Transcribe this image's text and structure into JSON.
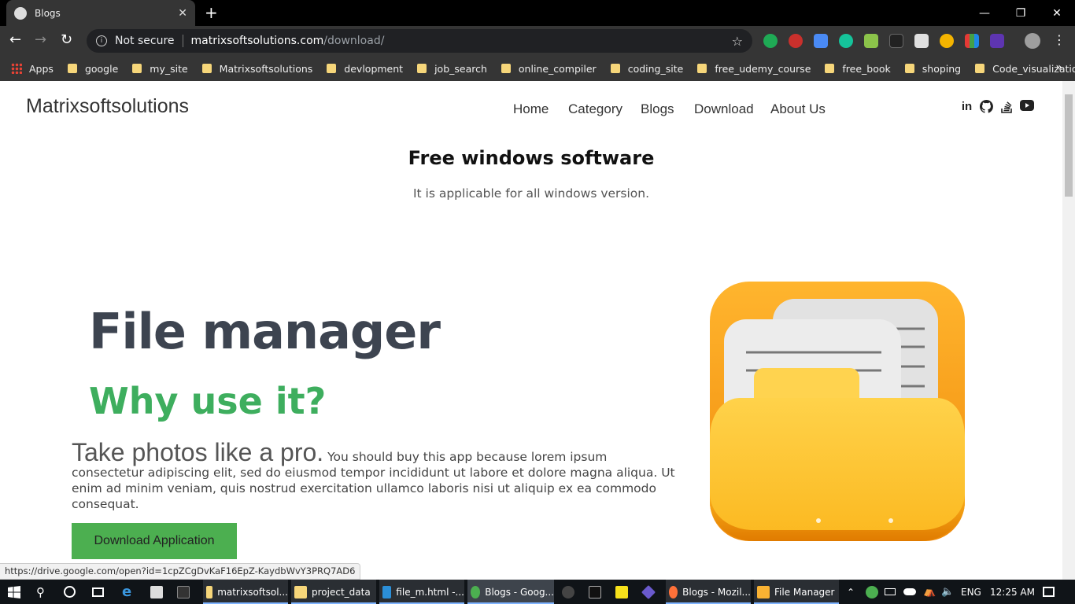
{
  "browser": {
    "tab_title": "Blogs",
    "tab_close": "✕",
    "new_tab": "+",
    "security": "Not secure",
    "url_host": "matrixsoftsolutions.com",
    "url_path": "/download/",
    "bookmarks": [
      "google",
      "my_site",
      "Matrixsoftsolutions",
      "devlopment",
      "job_search",
      "online_compiler",
      "coding_site",
      "free_udemy_course",
      "free_book",
      "shoping",
      "Code_visualization"
    ],
    "apps_label": "Apps"
  },
  "site": {
    "brand": "Matrixsoftsolutions",
    "menu": [
      "Home",
      "Category",
      "Blogs",
      "Download",
      "About Us"
    ],
    "section_title": "Free windows software",
    "section_subtitle": "It is applicable for all windows version.",
    "app_title": "File manager",
    "why_heading": "Why use it?",
    "lead": "Take photos like a pro.",
    "description": " You should buy this app because lorem ipsum consectetur adipiscing elit, sed do eiusmod tempor incididunt ut labore et dolore magna aliqua. Ut enim ad minim veniam, quis nostrud exercitation ullamco laboris nisi ut aliquip ex ea commodo consequat.",
    "download_button": "Download Application"
  },
  "status_url": "https://drive.google.com/open?id=1cpZCgDvKaF16EpZ-KaydbWvY3PRQ7AD6",
  "taskbar": {
    "items": [
      "matrixsoftsol...",
      "project_data",
      "file_m.html -...",
      "Blogs - Goog...",
      "Blogs - Mozil...",
      "File Manager"
    ],
    "language": "ENG",
    "time": "12:25 AM"
  },
  "colors": {
    "accent_green": "#3eae5e",
    "button_green": "#4caf50"
  }
}
